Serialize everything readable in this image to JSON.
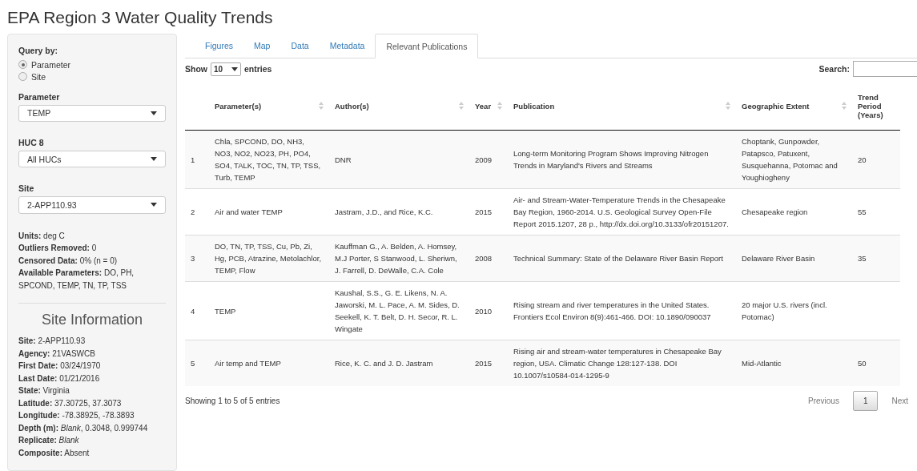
{
  "title": "EPA Region 3 Water Quality Trends",
  "sidebar": {
    "query_label": "Query by:",
    "query_options": [
      {
        "label": "Parameter",
        "selected": true
      },
      {
        "label": "Site",
        "selected": false
      }
    ],
    "selects": [
      {
        "label": "Parameter",
        "value": "TEMP"
      },
      {
        "label": "HUC 8",
        "value": "All HUCs"
      },
      {
        "label": "Site",
        "value": "2-APP110.93"
      }
    ],
    "summary": [
      "**Units:** deg C",
      "**Outliers Removed:** 0",
      "**Censored Data:** 0% (n = 0)",
      "**Available Parameters:** DO, PH, SPCOND, TEMP, TN, TP, TSS"
    ],
    "site_info_title": "Site Information",
    "site_info": [
      "**Site:** 2-APP110.93",
      "**Agency:** 21VASWCB",
      "**First Date:** 03/24/1970",
      "**Last Date:** 01/21/2016",
      "**State:** Virginia",
      "**Latitude:** 37.30725, 37.3073",
      "**Longitude:** -78.38925, -78.3893",
      "**Depth (m):** *Blank*, 0.3048, 0.999744",
      "**Replicate:** *Blank*",
      "**Composite:** Absent"
    ]
  },
  "tabs": [
    {
      "label": "Figures",
      "selected": false
    },
    {
      "label": "Map",
      "selected": false
    },
    {
      "label": "Data",
      "selected": false
    },
    {
      "label": "Metadata",
      "selected": false
    },
    {
      "label": "Relevant Publications",
      "selected": true
    }
  ],
  "length_control": {
    "before": "Show",
    "value": "10",
    "after": "entries"
  },
  "search": {
    "label": "Search:"
  },
  "table": {
    "columns": [
      {
        "label": "Parameter(s)",
        "sortable": true
      },
      {
        "label": "Author(s)",
        "sortable": true
      },
      {
        "label": "Year",
        "sortable": true
      },
      {
        "label": "Publication",
        "sortable": true
      },
      {
        "label": "Geographic Extent",
        "sortable": true
      },
      {
        "label": "Trend Period (Years)",
        "sortable": false
      }
    ],
    "rows": [
      {
        "index": "1",
        "cells": [
          "Chla, SPCOND, DO, NH3, NO3, NO2, NO23, PH, PO4, SO4, TALK, TOC, TN, TP, TSS, Turb, TEMP",
          "DNR",
          "2009",
          "Long-term Monitoring Program Shows Improving Nitrogen Trends in Maryland's Rivers and Streams",
          "Choptank, Gunpowder, Patapsco, Patuxent, Susquehanna, Potomac and Youghiogheny",
          "20"
        ]
      },
      {
        "index": "2",
        "cells": [
          "Air and water TEMP",
          "Jastram, J.D., and Rice, K.C.",
          "2015",
          "Air- and Stream-Water-Temperature Trends in the Chesapeake Bay Region, 1960-2014. U.S. Geological Survey Open-File Report 2015.1207, 28 p., http://dx.doi.org/10.3133/ofr20151207.",
          "Chesapeake region",
          "55"
        ]
      },
      {
        "index": "3",
        "cells": [
          "DO, TN, TP, TSS, Cu, Pb, Zi, Hg, PCB, Atrazine, Metolachlor, TEMP, Flow",
          "Kauffman G., A. Belden, A. Homsey, M.J Porter, S Stanwood, L. Sheriwn, J. Farrell, D. DeWalle, C.A. Cole",
          "2008",
          "Technical Summary: State of the Delaware River Basin Report",
          "Delaware River Basin",
          "35"
        ]
      },
      {
        "index": "4",
        "cells": [
          "TEMP",
          "Kaushal, S.S., G. E. Likens, N. A. Jaworski, M. L. Pace, A. M. Sides, D. Seekell, K. T. Belt, D. H. Secor, R. L. Wingate",
          "2010",
          "Rising stream and river temperatures in the United States. Frontiers Ecol Environ 8(9):461-466. DOI: 10.1890/090037",
          "20 major U.S. rivers (incl. Potomac)"
        ]
      },
      {
        "index": "5",
        "cells": [
          "Air temp and TEMP",
          "Rice, K. C. and J. D. Jastram",
          "2015",
          "Rising air and stream-water temperatures in Chesapeake Bay region, USA. Climatic Change 128:127-138. DOI 10.1007/s10584-014-1295-9",
          "Mid-Atlantic",
          "50"
        ]
      }
    ]
  },
  "info": "Showing 1 to 5 of 5 entries",
  "pagination": [
    {
      "label": "Previous",
      "selected": false
    },
    {
      "label": "1",
      "selected": true
    },
    {
      "label": "Next",
      "selected": false
    }
  ]
}
